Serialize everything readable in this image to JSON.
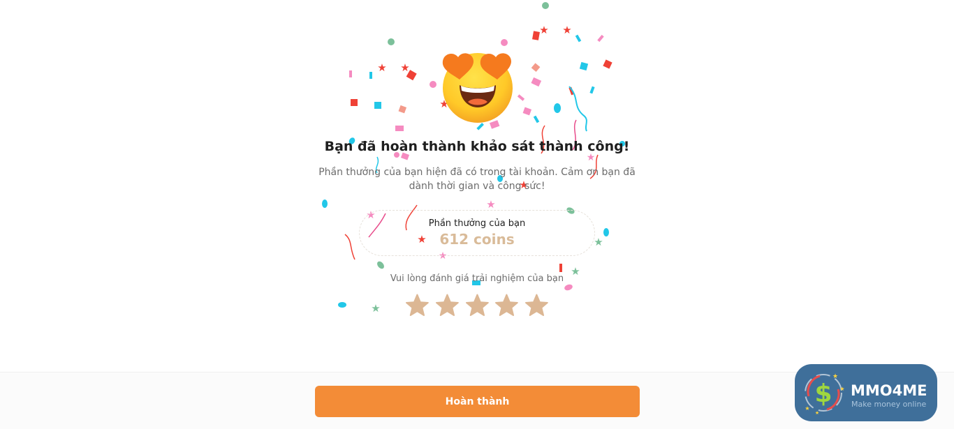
{
  "survey_complete": {
    "title": "Bạn đã hoàn thành khảo sát thành công!",
    "subtitle_line1": "Phần thưởng của bạn hiện đã có trong tài khoản. Cảm ơn bạn đã",
    "subtitle_line2": "dành thời gian và công sức!",
    "reward_label": "Phần thưởng của bạn",
    "reward_value": "612 coins",
    "rating_prompt": "Vui lòng đánh giá trải nghiệm của bạn",
    "rating": {
      "max": 5,
      "selected": 0
    },
    "emoji_icon": "heart-eyes-emoji-icon"
  },
  "footer": {
    "done_button_label": "Hoàn thành"
  },
  "watermark": {
    "name": "MMO4ME",
    "tagline": "Make money online"
  },
  "colors": {
    "accent": "#f38c37",
    "reward_text": "#d9bb99",
    "star": "#dcb794",
    "watermark_bg": "#3f6f9a"
  }
}
